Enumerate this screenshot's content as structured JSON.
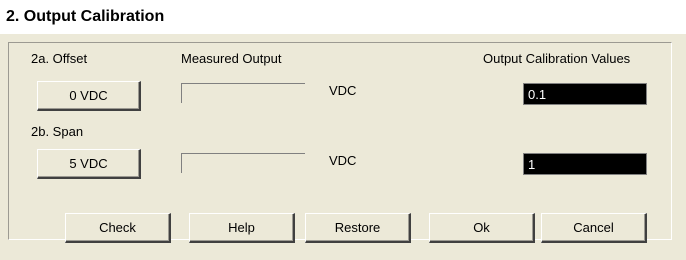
{
  "title": "2. Output Calibration",
  "offset": {
    "label": "2a. Offset",
    "button_label": "0 VDC",
    "unit": "VDC",
    "value": "0.1"
  },
  "span": {
    "label": "2b. Span",
    "button_label": "5 VDC",
    "unit": "VDC",
    "value": "1"
  },
  "headers": {
    "measured": "Measured Output",
    "calibration": "Output Calibration Values"
  },
  "buttons": {
    "check": "Check",
    "help": "Help",
    "restore": "Restore",
    "ok": "Ok",
    "cancel": "Cancel"
  }
}
